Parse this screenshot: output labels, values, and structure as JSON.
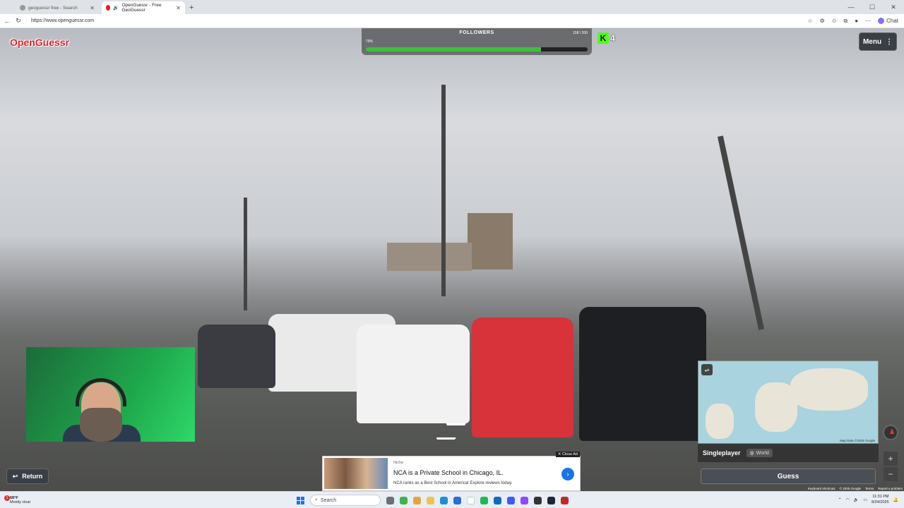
{
  "browser": {
    "tabs": [
      {
        "label": "geoguessr free - Search",
        "active": false
      },
      {
        "label": "OpenGuessr - Free GeoGuessr",
        "active": true
      }
    ],
    "url": "https://www.openguessr.com",
    "chat_label": "Chat"
  },
  "game": {
    "logo": "OpenGuessr",
    "followers": {
      "label": "FOLLOWERS",
      "percent_text": "79%",
      "count_text": "158 / 200",
      "progress": 0.79
    },
    "kick": {
      "letter": "K",
      "count": "4"
    },
    "menu_label": "Menu",
    "return_label": "Return",
    "mode": "Singleplayer",
    "region": "World",
    "guess_label": "Guess",
    "map_attribution": "Map Data ©2025 Google",
    "footer_links": [
      "Keyboard shortcuts",
      "© 2025 Google",
      "Terms",
      "Report a problem"
    ],
    "zoom_in": "+",
    "zoom_out": "−"
  },
  "ad": {
    "close_label": "✕ Close Ad",
    "source": "Niche",
    "headline": "NCA is a Private School in Chicago, IL.",
    "subline": "NCA ranks as a Best School in America! Explore reviews today."
  },
  "taskbar": {
    "weather_temp": "68°F",
    "weather_desc": "Mostly clear",
    "notification_count": "1",
    "search_placeholder": "Search",
    "time": "11:31 PM",
    "date": "8/24/2025"
  }
}
